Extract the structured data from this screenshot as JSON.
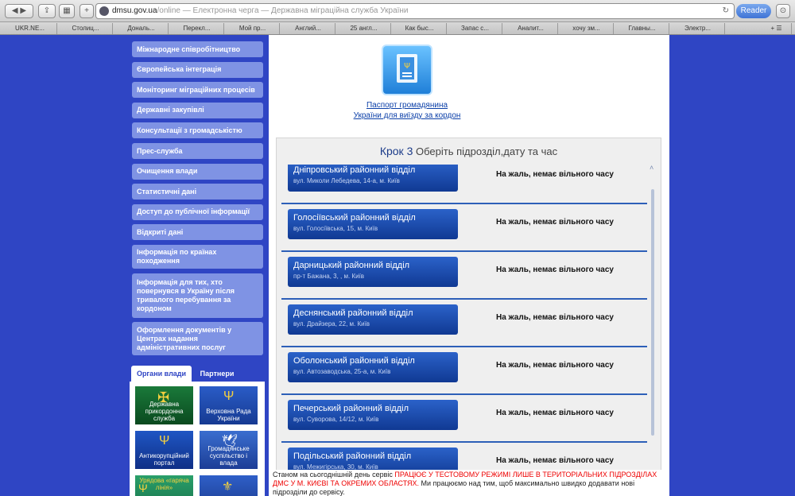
{
  "browser": {
    "url_host": "dmsu.gov.ua",
    "url_path": "/online",
    "page_title": " — Електронна черга — Державна міграційна служба України",
    "reader_label": "Reader",
    "bookmarks": [
      "UKR.NE...",
      "Столиц...",
      "Дональ...",
      "Перекл...",
      "Мой пр...",
      "Англий...",
      "25 англ...",
      "Как быс...",
      "Запас с...",
      "Аналит...",
      "хочу зм...",
      "Главны...",
      "Электр..."
    ]
  },
  "sidebar": {
    "items": [
      "Міжнародне співробітництво",
      "Європейська інтеграція",
      "Моніторинг міграційних процесів",
      "Державні закупівлі",
      "Консультації з громадськістю",
      "Прес-служба",
      "Очищення влади",
      "Статистичні дані",
      "Доступ до публічної інформації",
      "Відкриті дані",
      "Інформація по країнах походження",
      "Інформація для тих, хто повернувся в Україну після тривалого перебування за кордоном",
      "Оформлення документів у Центрах надання адміністративних послуг"
    ],
    "tabs": [
      "Органи влади",
      "Партнери"
    ],
    "tiles": [
      "Державна прикордонна служба",
      "Верховна Рада України",
      "Антикорупційний портал",
      "Громадянське суспільство і влада",
      "Урядова «гаряча лінія»",
      ""
    ]
  },
  "main": {
    "service_link_line1": "Паспорт громадянина",
    "service_link_line2": "України для виїзду за кордон",
    "step_label": "Крок 3",
    "step_text": "Оберіть підрозділ,дату та час",
    "departments": [
      {
        "name": "Дніпровський районний відділ",
        "address": "вул. Миколи Лебедева, 14-а, м. Київ",
        "status": "На жаль, немає вільного часу"
      },
      {
        "name": "Голосіївський районний відділ",
        "address": "вул. Голосіївська, 15, м. Київ",
        "status": "На жаль, немає вільного часу"
      },
      {
        "name": "Дарницький районний відділ",
        "address": "пр-т Бажана, 3, , м. Київ",
        "status": "На жаль, немає вільного часу"
      },
      {
        "name": "Деснянський районний відділ",
        "address": "вул. Драйзера, 22, м. Київ",
        "status": "На жаль, немає вільного часу"
      },
      {
        "name": "Оболонський районний відділ",
        "address": "вул. Автозаводська, 25-а, м. Київ",
        "status": "На жаль, немає вільного часу"
      },
      {
        "name": "Печерський районний відділ",
        "address": "вул. Суворова, 14/12, м. Київ",
        "status": "На жаль, немає вільного часу"
      },
      {
        "name": "Подільський районний відділ",
        "address": "вул. Межигірська, 30, м. Київ",
        "status": "На жаль, немає вільного часу"
      }
    ],
    "notice_prefix": "Станом на сьогоднішній день сервіс ",
    "notice_red": "ПРАЦЮЄ У ТЕСТОВОМУ РЕЖИМІ ЛИШЕ В ТЕРИТОРІАЛЬНИХ ПІДРОЗДІЛАХ ДМС У М. КИЄВІ ТА ОКРЕМИХ ОБЛАСТЯХ.",
    "notice_suffix": " Ми працюємо над тим, щоб максимально швидко додавати нові підрозділи до сервісу."
  }
}
